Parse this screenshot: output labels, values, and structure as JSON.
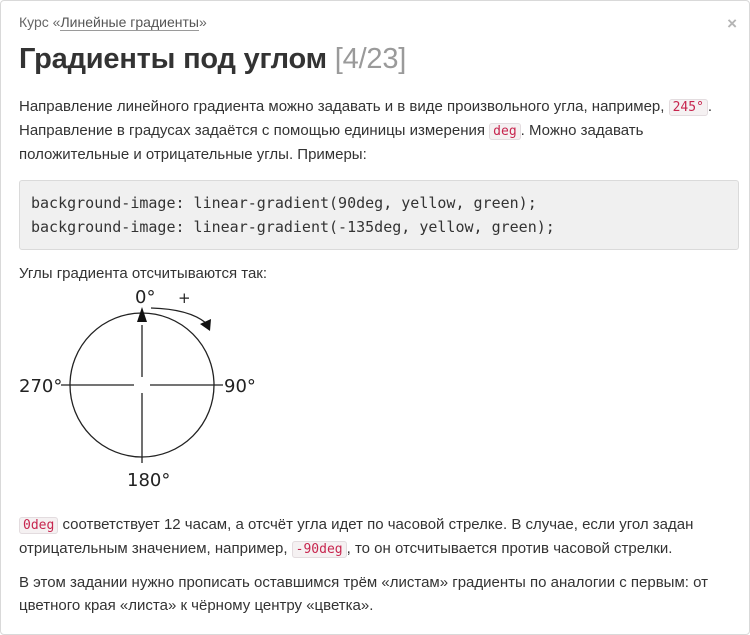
{
  "header": {
    "course_prefix": "Курс «",
    "course_link": "Линейные градиенты",
    "course_suffix": "»",
    "close_label": "×"
  },
  "lesson": {
    "title": "Градиенты под углом",
    "counter": "[4/23]"
  },
  "intro": {
    "part1": "Направление линейного градиента можно задавать и в виде произвольного угла, например, ",
    "code1": "245°",
    "part2": ". Направление в градусах задаётся с помощью единицы измерения ",
    "code2": "deg",
    "part3": ". Можно задавать положительные и отрицательные углы. Примеры:"
  },
  "code_example": {
    "line1": "background-image: linear-gradient(90deg, yellow, green);",
    "line2": "background-image: linear-gradient(-135deg, yellow, green);"
  },
  "angles_intro": "Углы градиента отсчитываются так:",
  "diagram": {
    "top": "0°",
    "right": "90°",
    "bottom": "180°",
    "left": "270°",
    "direction": "+"
  },
  "zero_para": {
    "code1": "0deg",
    "part1": " соответствует 12 часам, а отсчёт угла идет по часовой стрелке. В случае, если угол задан отрицательным значением, например, ",
    "code2": "-90deg",
    "part2": ", то он отсчитывается против часовой стрелки."
  },
  "task_para": "В этом задании нужно прописать оставшимся трём «листам» градиенты по аналогии с первым: от цветного края «листа» к чёрному центру «цветка»."
}
